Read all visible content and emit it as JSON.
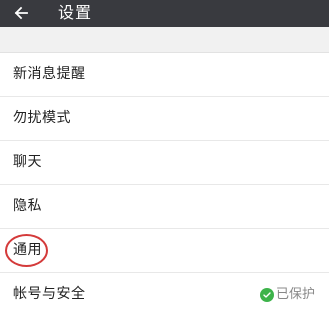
{
  "header": {
    "back_icon": "arrow-left-icon",
    "title": "设置"
  },
  "settings": {
    "items": [
      {
        "label": "新消息提醒"
      },
      {
        "label": "勿扰模式"
      },
      {
        "label": "聊天"
      },
      {
        "label": "隐私"
      },
      {
        "label": "通用",
        "highlighted": true
      },
      {
        "label": "帐号与安全",
        "status": "已保护",
        "status_icon": "shield-check-icon"
      }
    ]
  },
  "colors": {
    "topbar": "#393a3f",
    "highlight_circle": "#d43a3a",
    "status_green": "#3db34a"
  }
}
